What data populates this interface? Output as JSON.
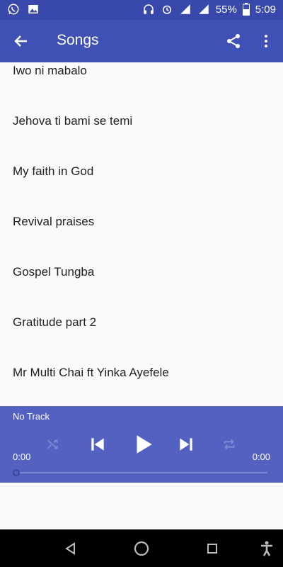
{
  "status_bar": {
    "icons_left": [
      "whatsapp-icon",
      "image-icon"
    ],
    "icons_right": [
      "headphones-icon",
      "alarm-icon",
      "signal-icon",
      "signal-icon"
    ],
    "battery": "55%",
    "time": "5:09"
  },
  "app_bar": {
    "title": "Songs",
    "icons": [
      "back-arrow-icon",
      "share-icon",
      "more-vert-icon"
    ]
  },
  "songs": [
    "Iwo ni mabalo",
    "Jehova ti bami se temi",
    "My faith in God",
    "Revival praises",
    "Gospel Tungba",
    "Gratitude part 2",
    "Mr Multi Chai ft Yinka Ayefele"
  ],
  "player": {
    "track": "No Track",
    "elapsed": "0:00",
    "duration": "0:00",
    "progress": 0,
    "controls": [
      "shuffle-icon",
      "skip-previous-icon",
      "play-icon",
      "skip-next-icon",
      "repeat-icon"
    ]
  },
  "nav_bar": {
    "icons": [
      "back-triangle-icon",
      "home-circle-icon",
      "recents-square-icon",
      "accessibility-icon"
    ]
  },
  "colors": {
    "app_bar": "#3f51b5",
    "status_bar": "#3949ab",
    "player": "#5362c1"
  }
}
